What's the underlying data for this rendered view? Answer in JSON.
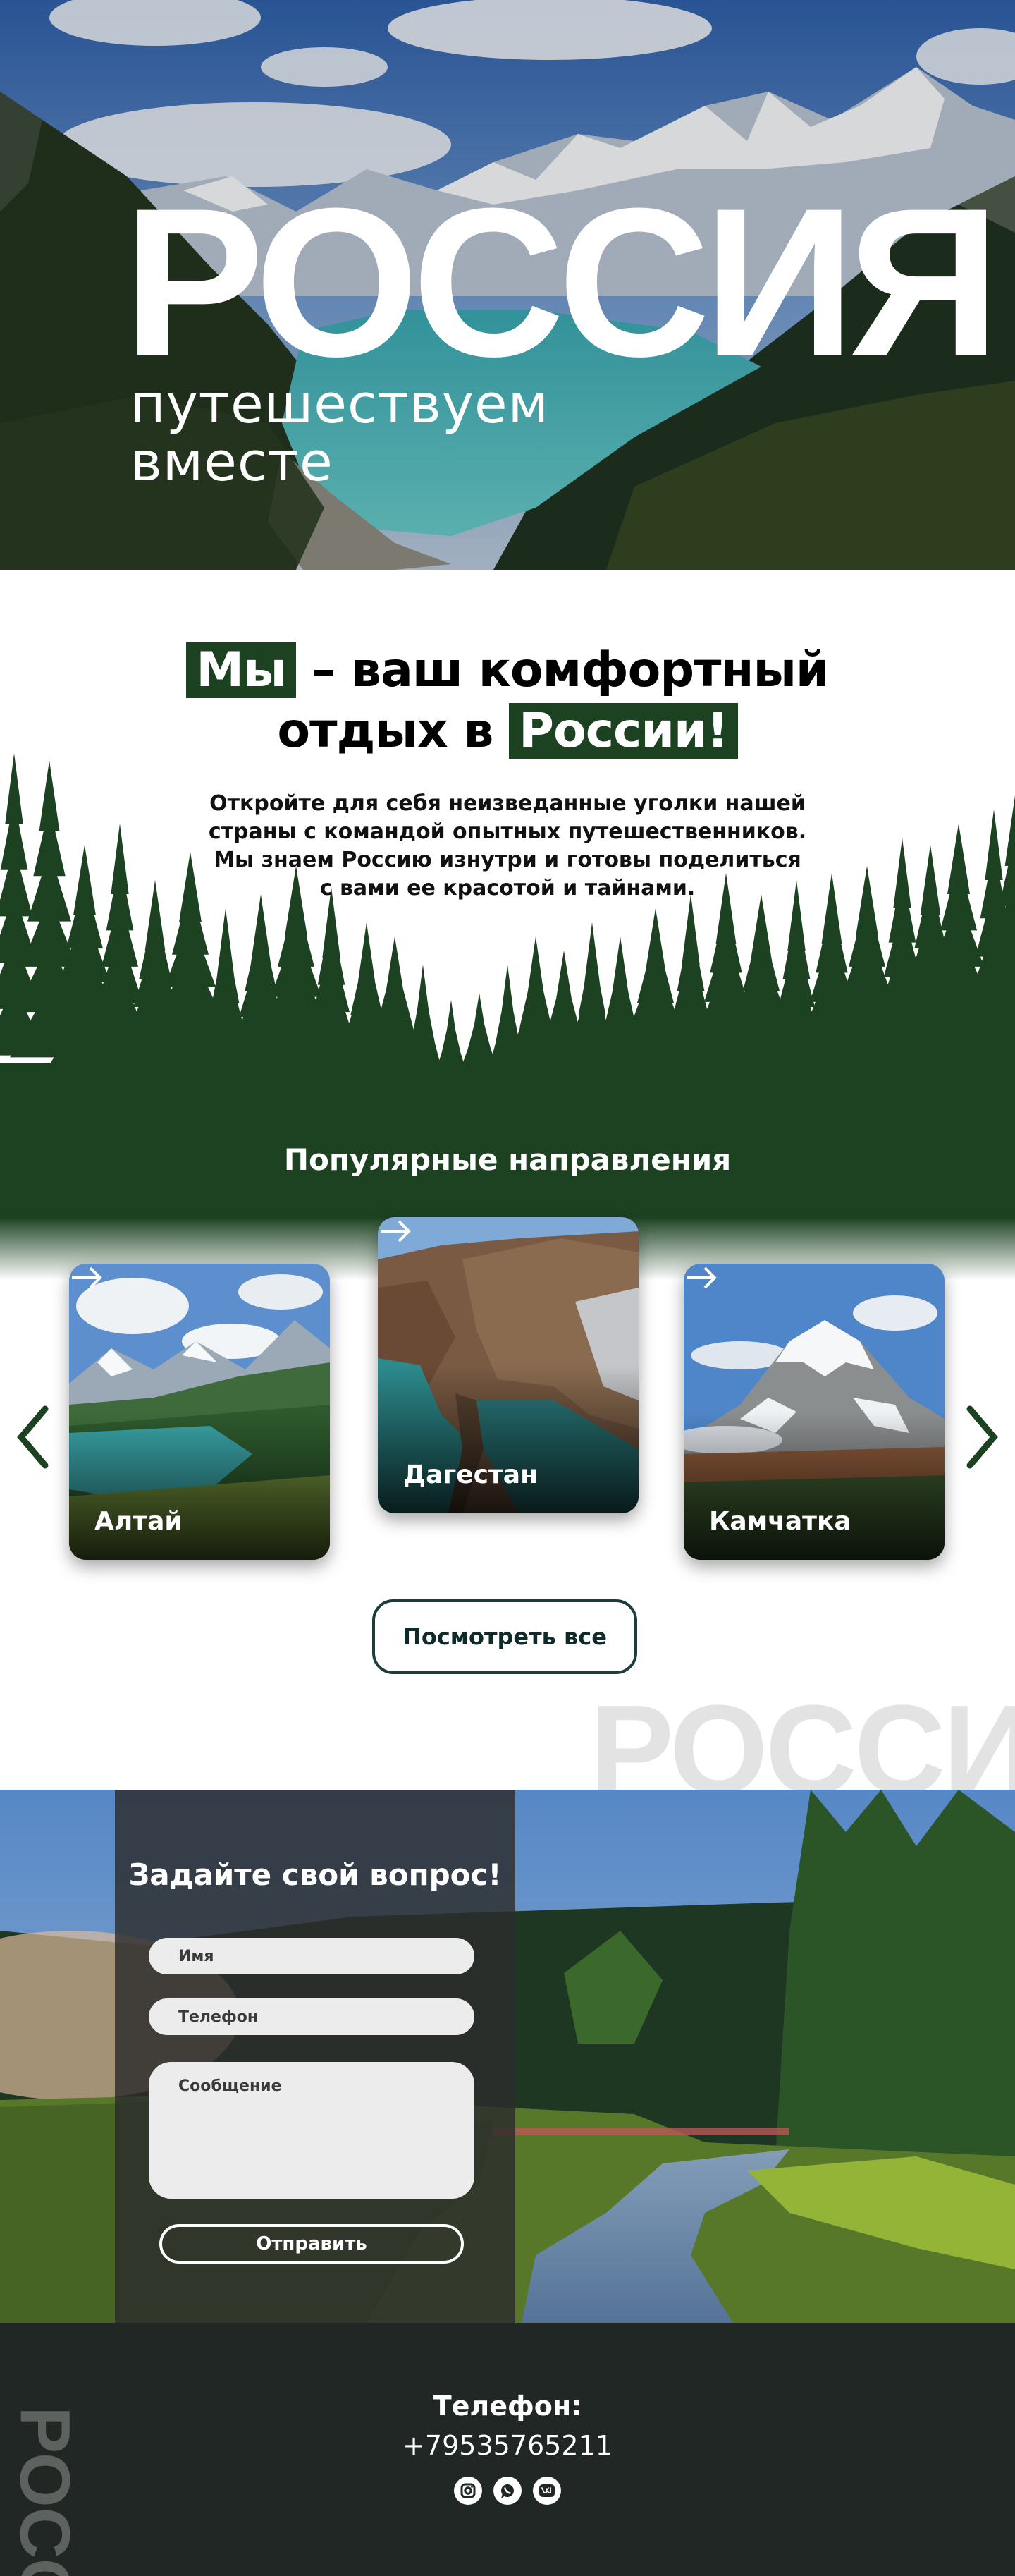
{
  "hero": {
    "title": "РОССИЯ",
    "subtitle": "путешествуем\nвместе"
  },
  "intro": {
    "headline_part1": "Мы",
    "headline_part2": " – ваш комфортный",
    "headline_part3": "отдых в ",
    "headline_part4": "России!",
    "text": "Откройте для себя неизведанные уголки нашей страны с командой опытных путешественников. Мы знаем Россию изнутри и готовы поделиться с вами ее красотой и тайнами."
  },
  "destinations": {
    "title": "Популярные направления",
    "cards": [
      {
        "name": "Алтай"
      },
      {
        "name": "Дагестан"
      },
      {
        "name": "Камчатка"
      }
    ],
    "view_all_label": "Посмотреть все"
  },
  "ghost_word": "РОССИЯ",
  "form": {
    "title": "Задайте свой вопрос!",
    "name_placeholder": "Имя",
    "phone_placeholder": "Телефон",
    "message_placeholder": "Сообщение",
    "submit_label": "Отправить"
  },
  "footer": {
    "vertical_word": "РОССИЯ",
    "phone_label": "Телефон:",
    "phone_number": "+79535765211",
    "socials": [
      "instagram-icon",
      "whatsapp-icon",
      "vk-icon"
    ]
  },
  "colors": {
    "forest_green": "#1c4221",
    "footer_bg": "#202724",
    "button_border": "#1d3d3c"
  }
}
